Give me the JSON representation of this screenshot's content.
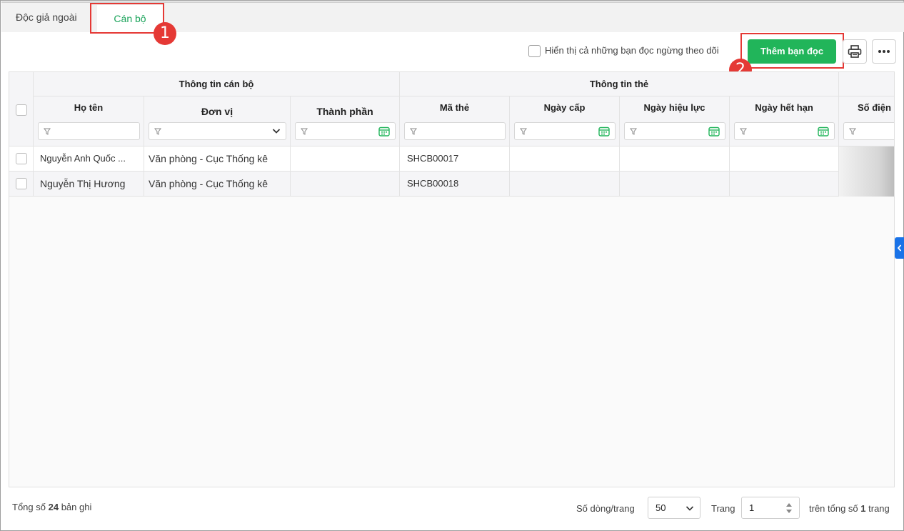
{
  "tabs": [
    {
      "label": "Độc giả ngoài",
      "active": false
    },
    {
      "label": "Cán bộ",
      "active": true
    }
  ],
  "annotations": [
    "1",
    "2"
  ],
  "toolbar": {
    "show_inactive_label": "Hiển thị cả những bạn đọc ngừng theo dõi",
    "add_button": "Thêm bạn đọc",
    "print_icon": "printer-icon",
    "more_icon": "ellipsis-icon"
  },
  "table": {
    "groups": [
      "Thông tin cán bộ",
      "Thông tin thẻ"
    ],
    "columns": [
      "Họ tên",
      "Đơn vị",
      "Thành phần",
      "Mã thẻ",
      "Ngày cấp",
      "Ngày hiệu lực",
      "Ngày hết hạn",
      "Số điện"
    ],
    "rows": [
      {
        "ho_ten": "Nguyễn Anh Quốc ...",
        "don_vi": "Văn phòng - Cục Thống kê",
        "thanh_phan": "",
        "ma_the": "SHCB00017",
        "ngay_cap": "",
        "ngay_hieu_luc": "",
        "ngay_het_han": ""
      },
      {
        "ho_ten": "Nguyễn Thị Hương",
        "don_vi": "Văn phòng - Cục Thống kê",
        "thanh_phan": "",
        "ma_the": "SHCB00018",
        "ngay_cap": "",
        "ngay_hieu_luc": "",
        "ngay_het_han": ""
      }
    ]
  },
  "footer": {
    "total_prefix": "Tổng số",
    "total_count": "24",
    "total_suffix": "bản ghi",
    "rows_per_page_label": "Số dòng/trang",
    "rows_per_page": "50",
    "page_label": "Trang",
    "page": "1",
    "of_total_prefix": "trên tổng số",
    "total_pages": "1",
    "of_total_suffix": "trang"
  },
  "colors": {
    "accent": "#21b55a",
    "annotation": "#e53935",
    "side_tab": "#1a73e8"
  }
}
